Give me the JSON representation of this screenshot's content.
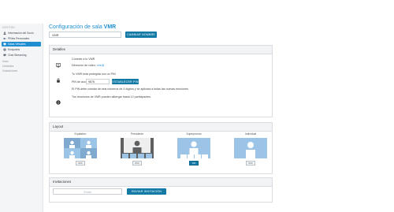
{
  "sidebar": {
    "section_label": "GESTIÓN",
    "items": [
      {
        "label": "Información del Socio",
        "icon": "person-icon"
      },
      {
        "label": "PINes Personales",
        "icon": "key-icon"
      },
      {
        "label": "Salas Virtuales",
        "icon": "monitor-icon",
        "active": true
      },
      {
        "label": "Endpoints",
        "icon": "gear-icon"
      },
      {
        "label": "Chat Streaming",
        "icon": "chat-icon"
      }
    ],
    "links": [
      "Inicio",
      "Unidades",
      "Grabaciones"
    ]
  },
  "page": {
    "title_prefix": "Configuración de sala",
    "title_strong": "VMR",
    "name_value": "VMR",
    "change_name_button": "CAMBIAR NOMBRE"
  },
  "details": {
    "header": "Detalles",
    "connect_text": "Conecte a tu VMR",
    "video_address_label": "Dirección de vídeo:",
    "video_address_value": "vmr@",
    "pin_protected_text": "Tu VMR está protegida con un PIN",
    "pin_access_label": "PIN de acceso",
    "pin_value": "9876",
    "set_pin_button": "ESTABLECER PIN",
    "pin_note": "El PIN debe constar de seis números de 4 dígitos y se aplicará a todas las nuevas reuniones",
    "capacity_text": "Tus reuniones de VMR pueden albergar hasta 12 participantes."
  },
  "layout": {
    "header": "Layout",
    "options": [
      {
        "label": "Equitativo",
        "toggle": "OFF",
        "on": false,
        "dark": false
      },
      {
        "label": "Presidente",
        "toggle": "OFF",
        "on": false,
        "dark": true
      },
      {
        "label": "Superpuesto",
        "toggle": "ON",
        "on": true,
        "dark": false
      },
      {
        "label": "Individual",
        "toggle": "OFF",
        "on": false,
        "dark": false
      }
    ]
  },
  "invitations": {
    "header": "Invitaciones",
    "email_placeholder": "Email",
    "send_button": "ENVIAR INVITACIÓN"
  },
  "colors": {
    "accent": "#1f8ed1",
    "button": "#137aa6",
    "thumb_light": "#9bc4e6",
    "thumb_dark": "#5d5f61"
  }
}
